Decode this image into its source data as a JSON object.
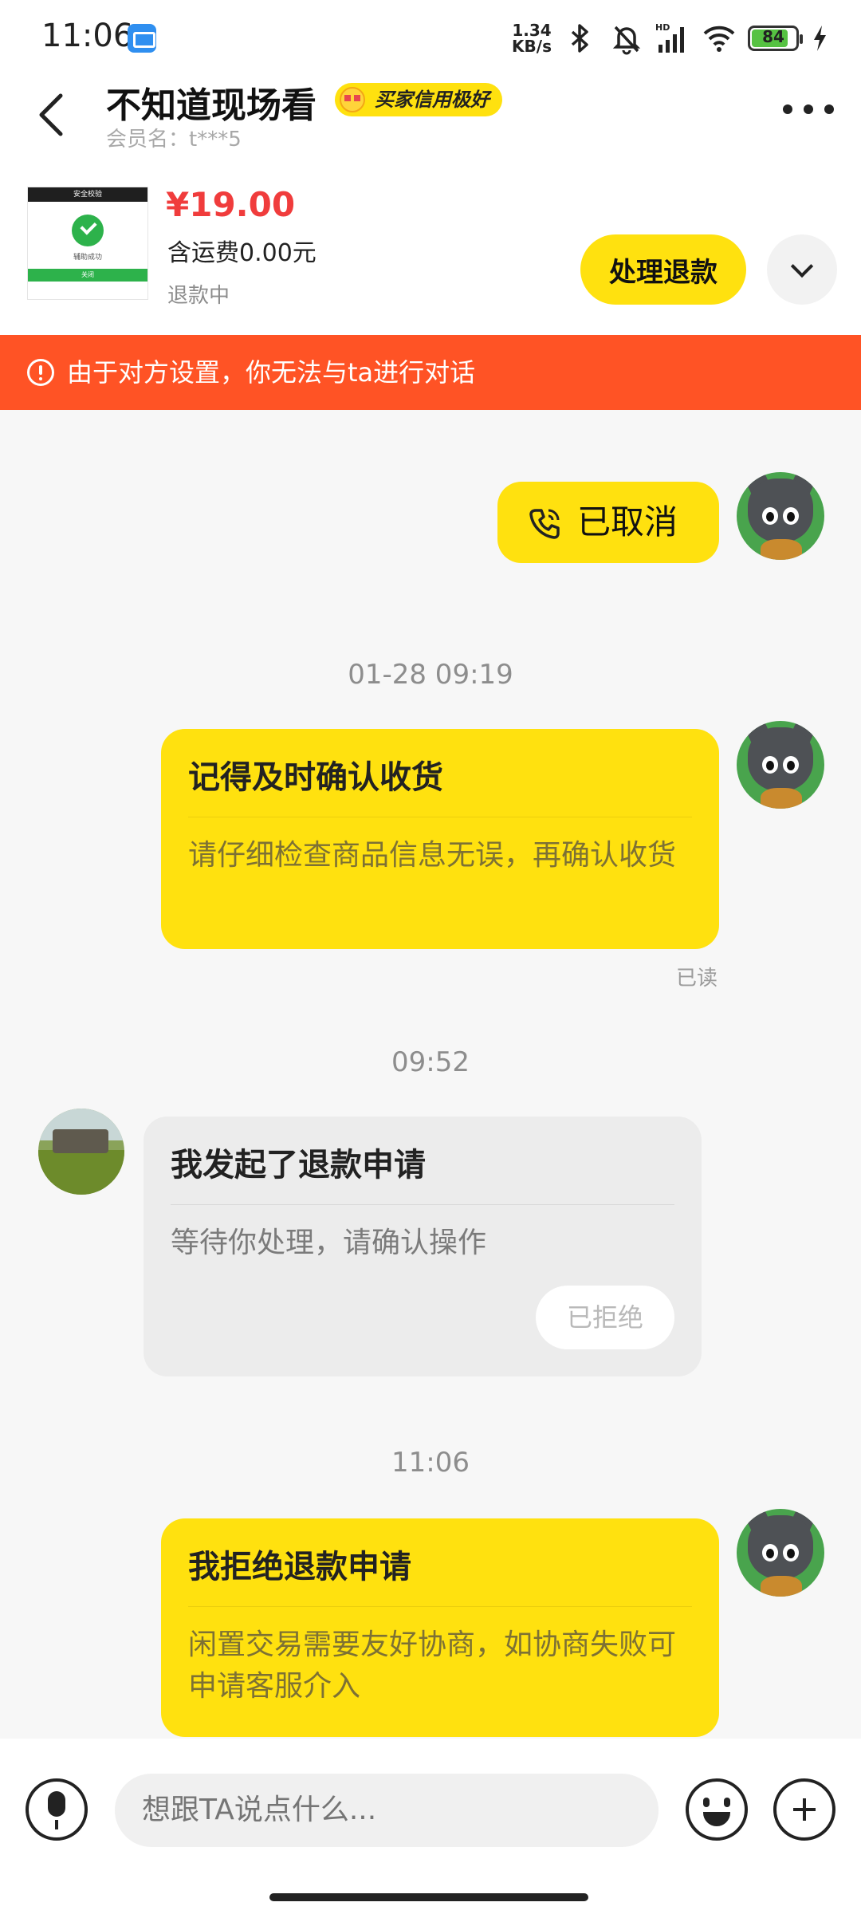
{
  "status_bar": {
    "time": "11:06",
    "net_speed_value": "1.34",
    "net_speed_unit": "KB/s",
    "network_label": "HD",
    "battery_level": "84",
    "icons": [
      "app-icon",
      "bluetooth-icon",
      "mute-bell-icon",
      "signal-icon",
      "wifi-icon",
      "battery-icon",
      "charging-icon"
    ]
  },
  "header": {
    "title": "不知道现场看",
    "badge": "买家信用极好",
    "member_label": "会员名：t***5"
  },
  "product": {
    "price": "¥19.00",
    "shipping": "含运费0.00元",
    "status": "退款中",
    "thumb_header": "安全校验",
    "thumb_text": "辅助成功",
    "thumb_button": "关闭",
    "action_label": "处理退款"
  },
  "warning": {
    "text": "由于对方设置，你无法与ta进行对话"
  },
  "messages": {
    "call_status": "已取消",
    "time1": "01-28 09:19",
    "card1_title": "记得及时确认收货",
    "card1_body": "请仔细检查商品信息无误，再确认收货",
    "read_status": "已读",
    "time2": "09:52",
    "card2_title": "我发起了退款申请",
    "card2_body": "等待你处理，请确认操作",
    "card2_button": "已拒绝",
    "time3": "11:06",
    "card3_title": "我拒绝退款申请",
    "card3_body": "闲置交易需要友好协商，如协商失败可申请客服介入"
  },
  "input": {
    "placeholder": "想跟TA说点什么..."
  },
  "colors": {
    "accent_yellow": "#ffe10f",
    "warning_orange": "#ff5325",
    "price_red": "#f03c3c"
  }
}
